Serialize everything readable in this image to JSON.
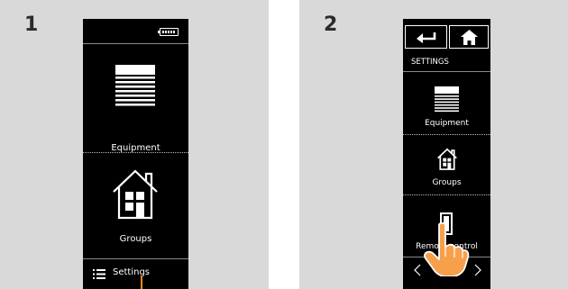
{
  "steps": {
    "step1": "1",
    "step2": "2"
  },
  "screen1": {
    "menu_items": [
      {
        "label": "Equipment",
        "icon": "blind-icon"
      },
      {
        "label": "Groups",
        "icon": "house-icon"
      }
    ],
    "bottom_bar": {
      "label": "Settings",
      "icon": "menu-list-icon"
    }
  },
  "screen2": {
    "header": {
      "back_icon": "back-arrow-icon",
      "home_icon": "home-icon"
    },
    "title": "SETTINGS",
    "menu_items": [
      {
        "label": "Equipment",
        "icon": "blind-icon"
      },
      {
        "label": "Groups",
        "icon": "house-icon"
      },
      {
        "label": "Remote control",
        "icon": "remote-icon"
      }
    ],
    "footer": {
      "prev_icon": "chevron-left-icon",
      "next_icon": "chevron-right-icon"
    }
  },
  "colors": {
    "panel_background": "#d9d9d9",
    "phone_background": "#000000",
    "pointer": "#f28a1c",
    "hand": "#f7a04b"
  }
}
